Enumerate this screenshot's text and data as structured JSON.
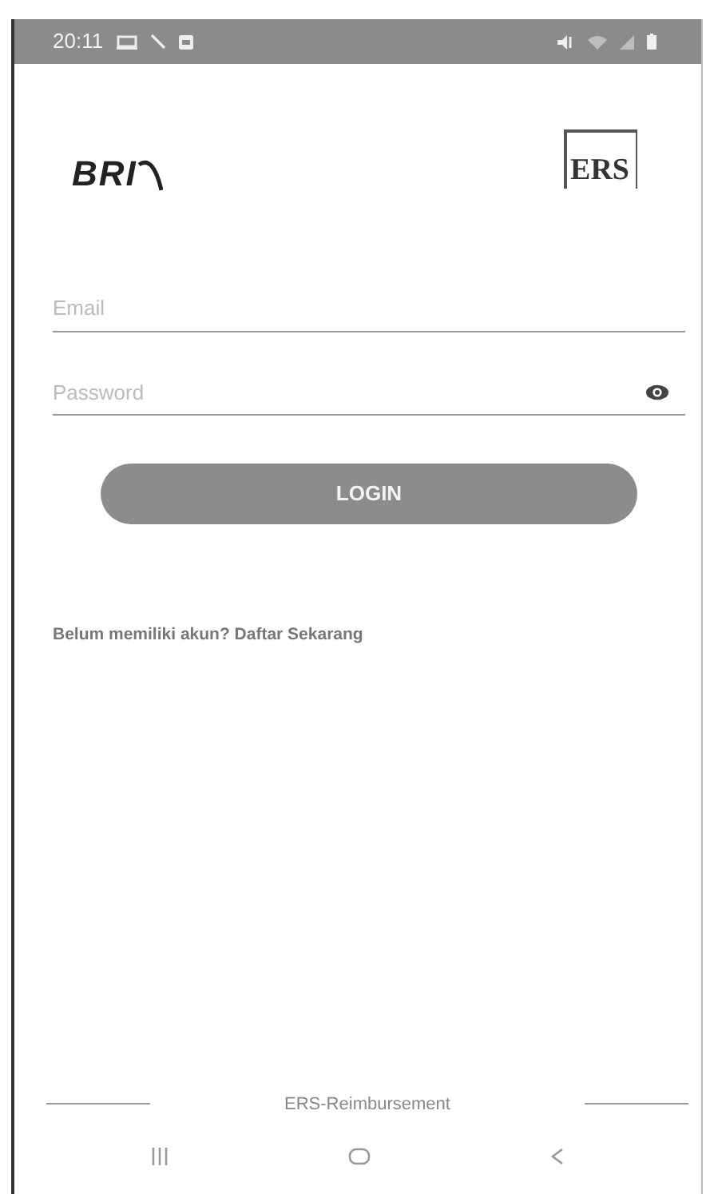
{
  "status_bar": {
    "time": "20:11"
  },
  "logos": {
    "left": "BRI",
    "right": "ERS"
  },
  "form": {
    "email": {
      "placeholder": "Email"
    },
    "password": {
      "placeholder": "Password"
    },
    "login_button": "LOGIN",
    "register_link": "Belum memiliki akun? Daftar Sekarang"
  },
  "footer": {
    "label": "ERS-Reimbursement"
  }
}
